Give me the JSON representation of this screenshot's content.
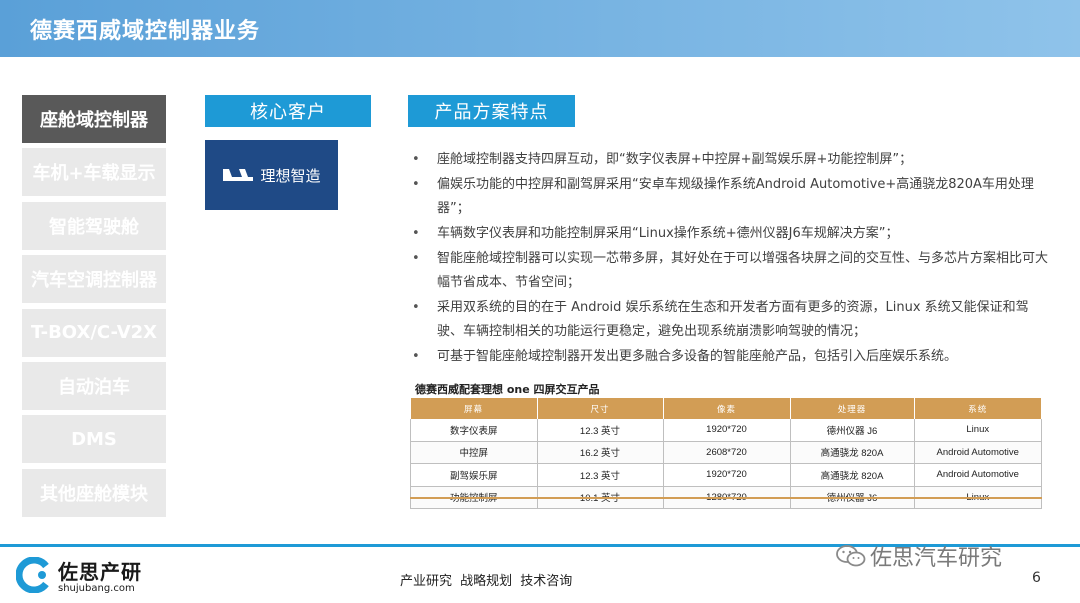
{
  "header": {
    "title": "德赛西威域控制器业务"
  },
  "sidebar": {
    "items": [
      {
        "label": "座舱域控制器",
        "active": true
      },
      {
        "label": "车机+车载显示",
        "active": false
      },
      {
        "label": "智能驾驶舱",
        "active": false
      },
      {
        "label": "汽车空调控制器",
        "active": false
      },
      {
        "label": "T-BOX/C-V2X",
        "active": false
      },
      {
        "label": "自动泊车",
        "active": false
      },
      {
        "label": "DMS",
        "active": false
      },
      {
        "label": "其他座舱模块",
        "active": false
      }
    ]
  },
  "customer": {
    "heading": "核心客户",
    "logo_text": "理想智造",
    "logo_icon": "li-auto-logo-icon"
  },
  "features": {
    "heading": "产品方案特点",
    "bullets": [
      "座舱域控制器支持四屏互动，即“数字仪表屏+中控屏+副驾娱乐屏+功能控制屏”；",
      "偏娱乐功能的中控屏和副驾屏采用“安卓车规级操作系统Android Automotive+高通骁龙820A车用处理器”；",
      "车辆数字仪表屏和功能控制屏采用“Linux操作系统+德州仪器J6车规解决方案”；",
      "智能座舱域控制器可以实现一芯带多屏，其好处在于可以增强各块屏之间的交互性、与多芯片方案相比可大幅节省成本、节省空间；",
      "采用双系统的目的在于 Android 娱乐系统在生态和开发者方面有更多的资源，Linux 系统又能保证和驾驶、车辆控制相关的功能运行更稳定，避免出现系统崩溃影响驾驶的情况；",
      "可基于智能座舱域控制器开发出更多融合多设备的智能座舱产品，包括引入后座娱乐系统。"
    ]
  },
  "table": {
    "title": "德赛西威配套理想 one 四屏交互产品",
    "headers": [
      "屏幕",
      "尺寸",
      "像素",
      "处理器",
      "系统"
    ],
    "rows": [
      [
        "数字仪表屏",
        "12.3 英寸",
        "1920*720",
        "德州仪器 J6",
        "Linux"
      ],
      [
        "中控屏",
        "16.2 英寸",
        "2608*720",
        "高通骁龙 820A",
        "Android Automotive"
      ],
      [
        "副驾娱乐屏",
        "12.3 英寸",
        "1920*720",
        "高通骁龙 820A",
        "Android Automotive"
      ],
      [
        "功能控制屏",
        "10.1 英寸",
        "1280*720",
        "德州仪器 J6",
        "Linux"
      ]
    ]
  },
  "footer": {
    "brand_cn": "佐思产研",
    "brand_en": "shujubang.com",
    "links": "产业研究 战略规划 技术咨询",
    "wechat_text": "佐思汽车研究",
    "page_number": "6"
  },
  "colors": {
    "accent": "#1e9ad6",
    "table_header": "#d29d55",
    "active_tab": "#595959",
    "inactive_tab": "#e9e9e9"
  }
}
